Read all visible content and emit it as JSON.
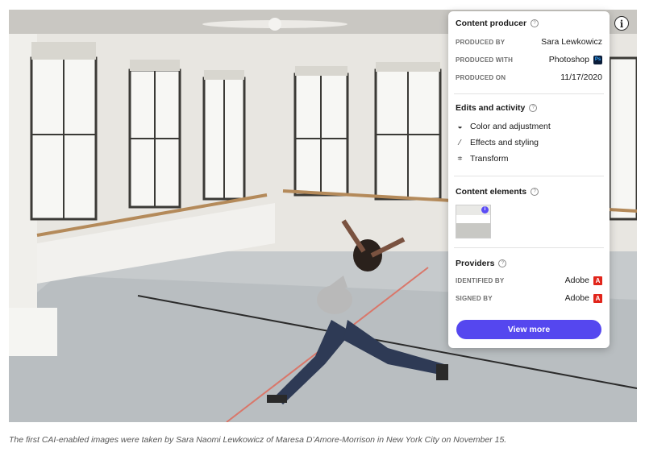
{
  "panel": {
    "content_producer": {
      "title": "Content producer",
      "rows": [
        {
          "label": "PRODUCED BY",
          "value": "Sara Lewkowicz"
        },
        {
          "label": "PRODUCED WITH",
          "value": "Photoshop",
          "icon": "photoshop-icon",
          "icon_text": "Ps"
        },
        {
          "label": "PRODUCED ON",
          "value": "11/17/2020"
        }
      ]
    },
    "edits": {
      "title": "Edits and activity",
      "items": [
        {
          "label": "Color and adjustment",
          "icon": "color-adjust-icon"
        },
        {
          "label": "Effects and styling",
          "icon": "effects-wand-icon"
        },
        {
          "label": "Transform",
          "icon": "transform-icon"
        }
      ]
    },
    "content_elements": {
      "title": "Content elements",
      "badge": "i"
    },
    "providers": {
      "title": "Providers",
      "rows": [
        {
          "label": "IDENTIFIED BY",
          "value": "Adobe",
          "icon": "adobe-icon"
        },
        {
          "label": "SIGNED BY",
          "value": "Adobe",
          "icon": "adobe-icon"
        }
      ]
    },
    "button_label": "View more"
  },
  "info_button": "i",
  "caption": "The first CAI-enabled images were taken by Sara Naomi Lewkowicz of Maresa D’Amore-Morrison in New York City on November 15.",
  "colors": {
    "accent": "#5547ef",
    "adobe_red": "#e1251b"
  }
}
